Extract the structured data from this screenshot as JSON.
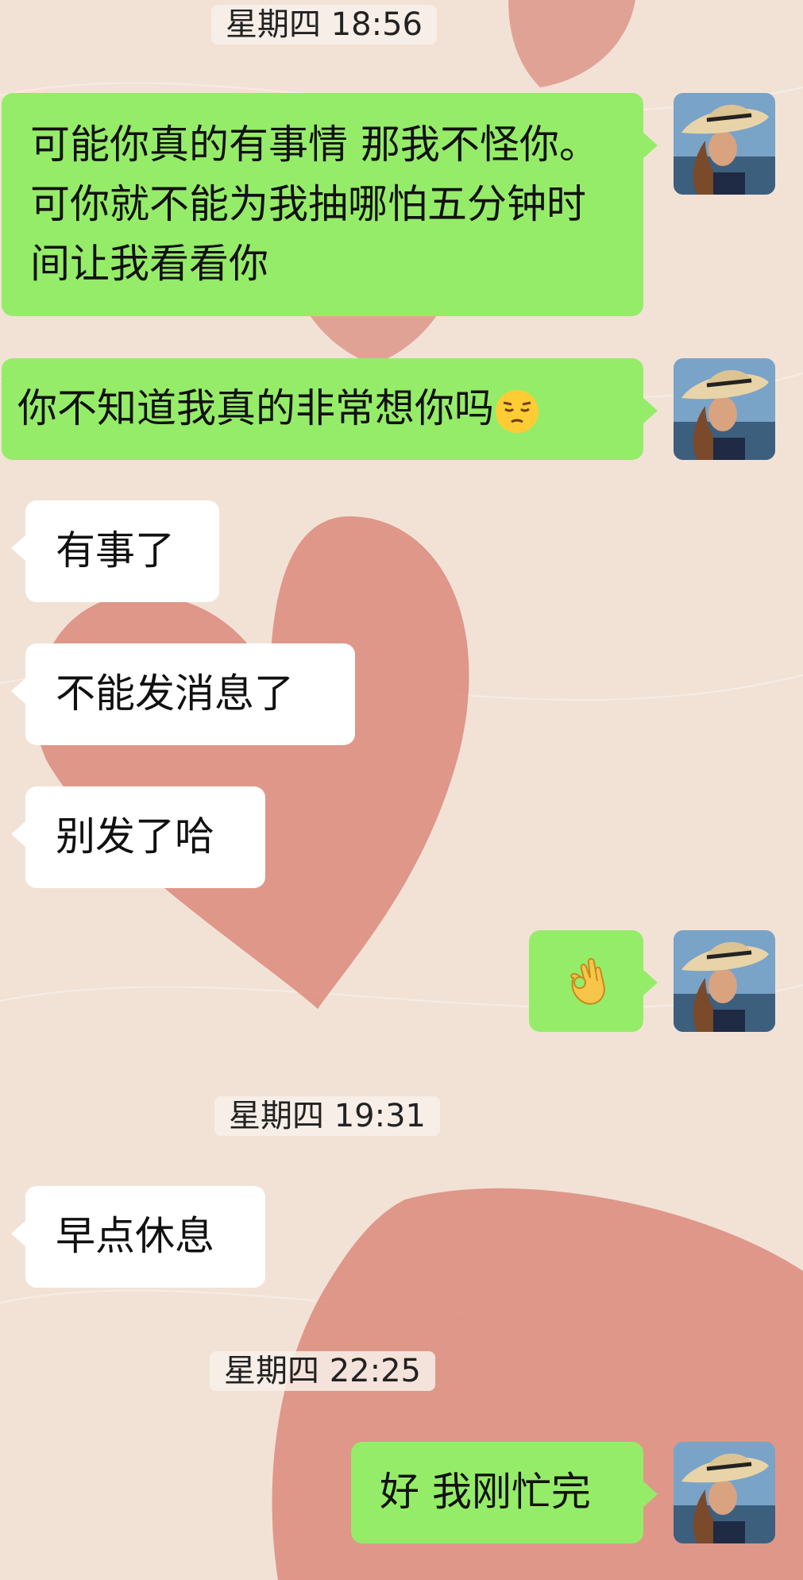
{
  "conversation": {
    "timestamps": [
      "星期四 18:56",
      "星期四 19:31",
      "星期四 22:25"
    ],
    "messages": [
      {
        "sender": "me",
        "text": "可能你真的有事情 那我不怪你。可你就不能为我抽哪怕五分钟时间让我看看你"
      },
      {
        "sender": "me",
        "text": "你不知道我真的非常想你吗"
      },
      {
        "sender": "them",
        "text": "有事了"
      },
      {
        "sender": "them",
        "text": "不能发消息了"
      },
      {
        "sender": "them",
        "text": "别发了哈"
      },
      {
        "sender": "me",
        "text": ""
      },
      {
        "sender": "them",
        "text": "早点休息"
      },
      {
        "sender": "me",
        "text": "好 我刚忙完"
      }
    ]
  },
  "icons": {
    "pensive_emoji": "pensive-face-icon",
    "ok_hand_emoji": "ok-hand-icon",
    "avatar": "woman-in-sunhat-avatar"
  },
  "colors": {
    "my_bubble": "#95ec69",
    "their_bubble": "#ffffff",
    "background": "#f2e2d6",
    "heart": "#d88a7c"
  }
}
